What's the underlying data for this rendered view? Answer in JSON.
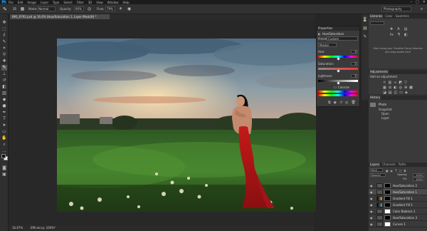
{
  "app": {
    "logo": "Ps"
  },
  "menu": [
    "File",
    "Edit",
    "Image",
    "Layer",
    "Type",
    "Select",
    "Filter",
    "3D",
    "View",
    "Window",
    "Help"
  ],
  "window_controls": [
    "–",
    "▢",
    "✕"
  ],
  "options_bar": {
    "brush_size": "35",
    "mode_label": "Mode:",
    "mode_value": "Normal",
    "opacity_label": "Opacity:",
    "opacity_value": "60%",
    "flow_label": "Flow:",
    "flow_value": "79%",
    "workspace": "Photography"
  },
  "document": {
    "tab_title": "IMG_9792.psd @ 16.6% (Hue/Saturation 1, Layer Mask/8) *",
    "zoom": "16.67%",
    "doc_info": "Efficiency: 100%*"
  },
  "properties": {
    "header": "Properties",
    "title": "Hue/Saturation",
    "preset_label": "Preset:",
    "preset_value": "Custom",
    "channel_value": "Master",
    "hue_label": "Hue:",
    "hue_value": "0",
    "saturation_label": "Saturation:",
    "saturation_value": "0",
    "lightness_label": "Lightness:",
    "lightness_value": "0",
    "colorize_label": "Colorize"
  },
  "panel_tabs_top": [
    "Libraries",
    "Color",
    "Swatches"
  ],
  "libraries": {
    "message": "Start using your Creative Cloud Libraries and drag assets here"
  },
  "adjustments": {
    "tab": "Adjustments",
    "add_label": "Add an adjustment"
  },
  "history": {
    "tab": "History",
    "items": [
      "Photo",
      "Snapshot",
      "Open",
      "Layer"
    ]
  },
  "layers": {
    "tabs": [
      "Layers",
      "Channels",
      "Paths"
    ],
    "kind_label": "Kind",
    "blend_mode": "Normal",
    "opacity_label": "Opacity:",
    "opacity_value": "100%",
    "fill_label": "Fill:",
    "fill_value": "100%",
    "rows": [
      {
        "name": "Hue/Saturation 2"
      },
      {
        "name": "Hue/Saturation 1"
      },
      {
        "name": "Gradient Fill 1"
      },
      {
        "name": "Gradient Fill 1"
      },
      {
        "name": "Color Balance 1"
      },
      {
        "name": "Hue/Saturation 3"
      },
      {
        "name": "Curves 1"
      }
    ]
  }
}
